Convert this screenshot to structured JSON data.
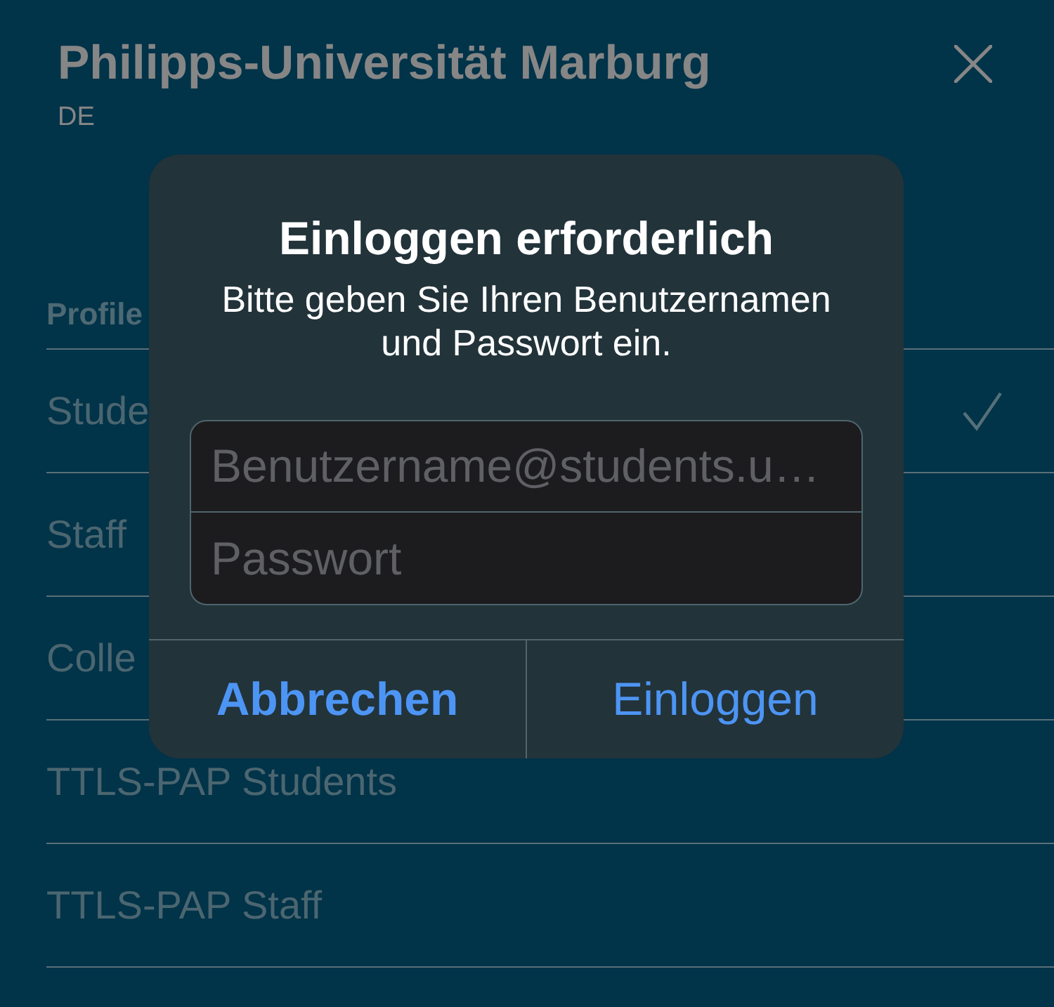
{
  "header": {
    "title": "Philipps-Universität Marburg",
    "subtitle": "DE"
  },
  "profiles": {
    "heading": "Profile",
    "items": [
      {
        "label": "Stude",
        "selected": true
      },
      {
        "label": "Staff",
        "selected": false
      },
      {
        "label": "Colle",
        "selected": false
      },
      {
        "label": "TTLS-PAP Students",
        "selected": false
      },
      {
        "label": "TTLS-PAP Staff",
        "selected": false
      }
    ]
  },
  "dialog": {
    "title": "Einloggen erforderlich",
    "message": "Bitte geben Sie Ihren Benutzernamen und Passwort ein.",
    "fields": [
      {
        "placeholder": "Benutzername@students.u…"
      },
      {
        "placeholder": "Passwort"
      }
    ],
    "buttons": [
      {
        "kind": "cancel",
        "label": "Abbrechen"
      },
      {
        "kind": "default",
        "label": "Einloggen"
      }
    ]
  }
}
